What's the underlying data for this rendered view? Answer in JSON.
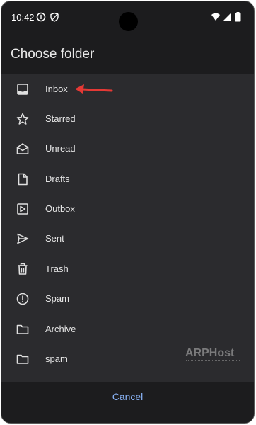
{
  "status_bar": {
    "time": "10:42",
    "icons": [
      "info-icon",
      "shield-icon",
      "wifi-icon",
      "signal-icon",
      "battery-icon"
    ]
  },
  "dialog": {
    "title": "Choose folder",
    "cancel_label": "Cancel"
  },
  "folders": [
    {
      "label": "Inbox",
      "icon": "inbox-icon"
    },
    {
      "label": "Starred",
      "icon": "star-icon"
    },
    {
      "label": "Unread",
      "icon": "unread-mail-icon"
    },
    {
      "label": "Drafts",
      "icon": "draft-icon"
    },
    {
      "label": "Outbox",
      "icon": "outbox-icon"
    },
    {
      "label": "Sent",
      "icon": "send-icon"
    },
    {
      "label": "Trash",
      "icon": "trash-icon"
    },
    {
      "label": "Spam",
      "icon": "spam-icon"
    },
    {
      "label": "Archive",
      "icon": "folder-icon"
    },
    {
      "label": "spam",
      "icon": "folder-icon"
    }
  ],
  "annotation": {
    "arrow_color": "#e53935"
  },
  "watermark": {
    "text": "ARPHost"
  },
  "colors": {
    "background": "#1c1c1e",
    "list_background": "#2b2b2e",
    "accent": "#8ab4f8",
    "text": "#e4e4e4"
  }
}
